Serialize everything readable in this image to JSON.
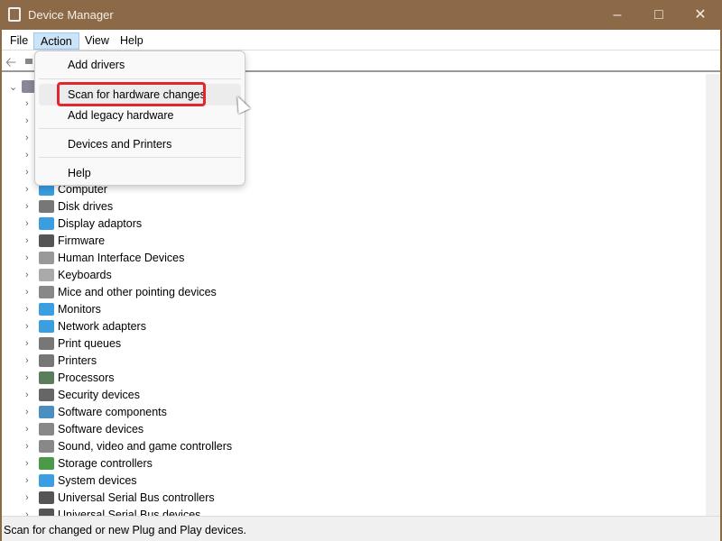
{
  "window": {
    "title": "Device Manager"
  },
  "menubar": [
    "File",
    "Action",
    "View",
    "Help"
  ],
  "action_menu": {
    "items": [
      "Add drivers",
      "Scan for hardware changes",
      "Add legacy hardware",
      "Devices and Printers",
      "Help"
    ],
    "highlighted": "Scan for hardware changes"
  },
  "tree": {
    "categories": [
      {
        "label": "Computer",
        "color": "#3a9ee0"
      },
      {
        "label": "Disk drives",
        "color": "#777"
      },
      {
        "label": "Display adaptors",
        "color": "#3a9ee0"
      },
      {
        "label": "Firmware",
        "color": "#555"
      },
      {
        "label": "Human Interface Devices",
        "color": "#999"
      },
      {
        "label": "Keyboards",
        "color": "#aaa"
      },
      {
        "label": "Mice and other pointing devices",
        "color": "#888"
      },
      {
        "label": "Monitors",
        "color": "#3a9ee0"
      },
      {
        "label": "Network adapters",
        "color": "#3a9ee0"
      },
      {
        "label": "Print queues",
        "color": "#777"
      },
      {
        "label": "Printers",
        "color": "#777"
      },
      {
        "label": "Processors",
        "color": "#5b7d5b"
      },
      {
        "label": "Security devices",
        "color": "#666"
      },
      {
        "label": "Software components",
        "color": "#4a8fbf"
      },
      {
        "label": "Software devices",
        "color": "#888"
      },
      {
        "label": "Sound, video and game controllers",
        "color": "#888"
      },
      {
        "label": "Storage controllers",
        "color": "#4a9a4a"
      },
      {
        "label": "System devices",
        "color": "#3a9ee0"
      },
      {
        "label": "Universal Serial Bus controllers",
        "color": "#555"
      },
      {
        "label": "Universal Serial Bus devices",
        "color": "#555"
      }
    ]
  },
  "status": "Scan for changed or new Plug and Play devices."
}
